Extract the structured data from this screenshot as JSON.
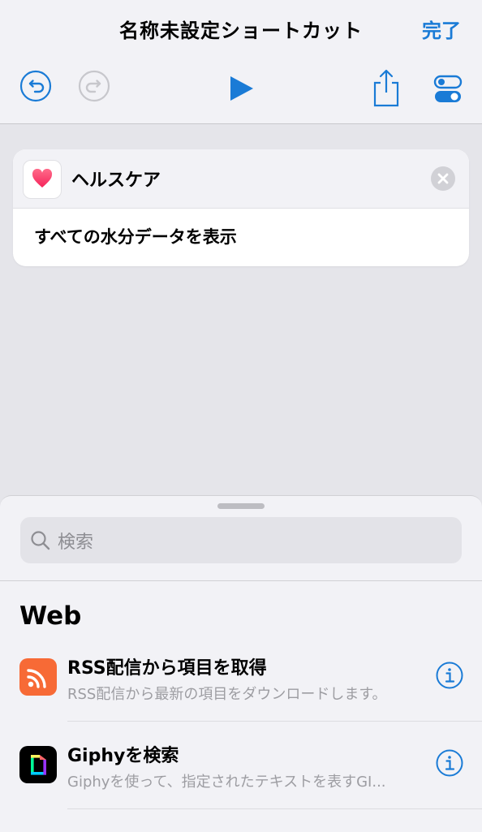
{
  "header": {
    "title": "名称未設定ショートカット",
    "done_label": "完了",
    "accent_color": "#1a7bd6",
    "toolbar_icons": [
      "undo-icon",
      "redo-icon",
      "play-icon",
      "share-icon",
      "settings-toggle-icon"
    ]
  },
  "action_card": {
    "app_name": "ヘルスケア",
    "app_icon": "heart-icon",
    "action_text": "すべての水分データを表示"
  },
  "sheet": {
    "search_placeholder": "検索",
    "section_title": "Web",
    "items": [
      {
        "title": "RSS配信から項目を取得",
        "subtitle": "RSS配信から最新の項目をダウンロードします。",
        "icon": "rss-icon",
        "icon_color": "#f76a36"
      },
      {
        "title": "Giphyを検索",
        "subtitle": "Giphyを使って、指定されたテキストを表すGI...",
        "icon": "giphy-icon",
        "icon_color": "#000000"
      }
    ]
  }
}
